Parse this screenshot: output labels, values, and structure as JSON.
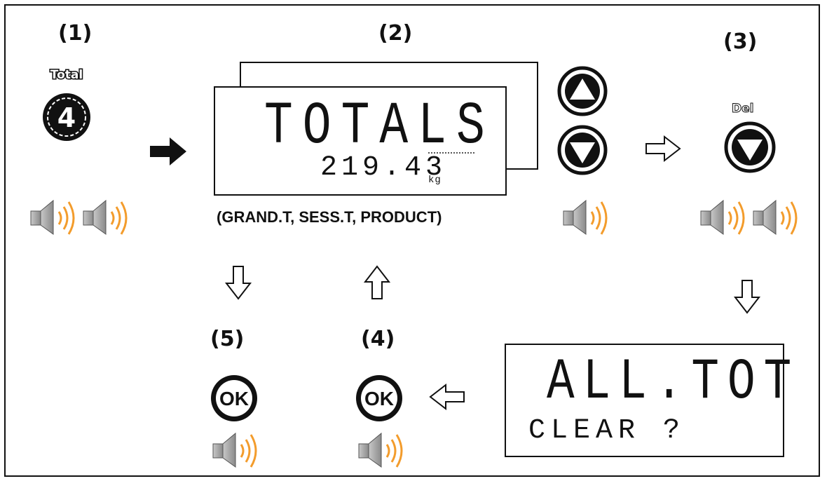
{
  "steps": {
    "s1": "(1)",
    "s2": "(2)",
    "s3": "(3)",
    "s4": "(4)",
    "s5": "(5)"
  },
  "total_key": {
    "label": "Total",
    "number": "4"
  },
  "lcd_totals": {
    "main": "TOTALS",
    "value": "219.43",
    "unit": "kg"
  },
  "totals_caption": "(GRAND.T, SESS.T, PRODUCT)",
  "del_key": {
    "label": "Del"
  },
  "lcd_clear": {
    "main": "ALL.TOT",
    "sub": "CLEAR ?"
  },
  "ok_label": "OK",
  "colors": {
    "sound_wave": "#f39c2c",
    "ink": "#111111"
  }
}
